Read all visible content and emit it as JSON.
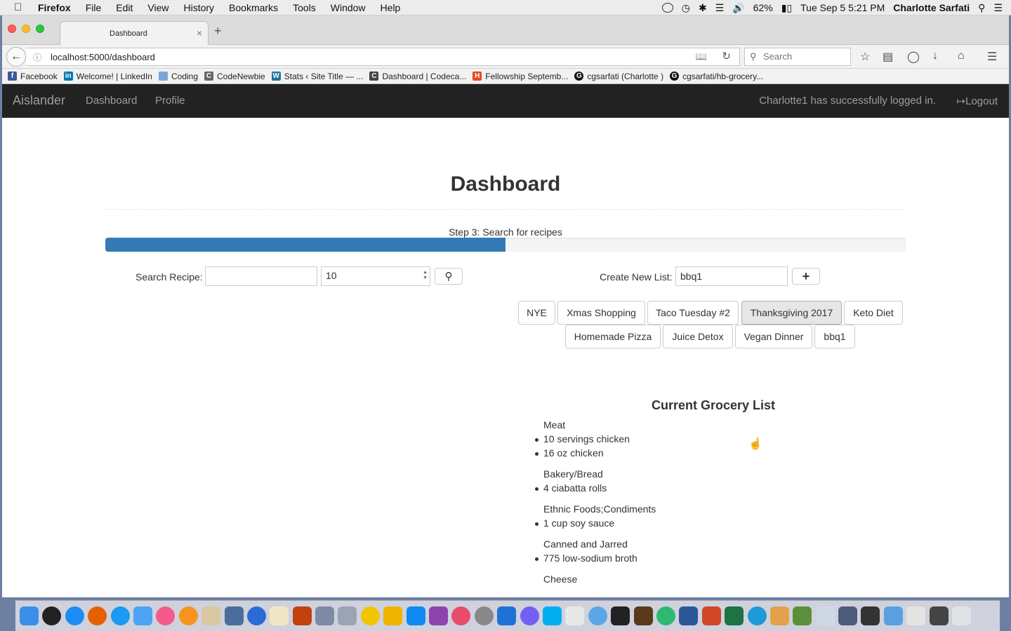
{
  "menubar": {
    "app": "Firefox",
    "menus": [
      "File",
      "Edit",
      "View",
      "History",
      "Bookmarks",
      "Tools",
      "Window",
      "Help"
    ],
    "battery": "62%",
    "clock": "Tue Sep 5  5:21 PM",
    "user": "Charlotte Sarfati"
  },
  "browser": {
    "tab_title": "Dashboard",
    "url": "localhost:5000/dashboard",
    "search_placeholder": "Search",
    "bookmarks": [
      {
        "label": "Facebook",
        "color": "#3b5998",
        "glyph": "f"
      },
      {
        "label": "Welcome! | LinkedIn",
        "color": "#0077b5",
        "glyph": "in"
      },
      {
        "label": "Coding",
        "color": "#7aa7d8",
        "glyph": ""
      },
      {
        "label": "CodeNewbie",
        "color": "#666666",
        "glyph": "C"
      },
      {
        "label": "Stats ‹ Site Title — ...",
        "color": "#21759b",
        "glyph": "W"
      },
      {
        "label": "Dashboard | Codeca...",
        "color": "#444444",
        "glyph": "C"
      },
      {
        "label": "Fellowship Septemb...",
        "color": "#e8491d",
        "glyph": "H"
      },
      {
        "label": "cgsarfati (Charlotte )",
        "color": "#111111",
        "glyph": "G"
      },
      {
        "label": "cgsarfati/hb-grocery...",
        "color": "#111111",
        "glyph": "G"
      }
    ]
  },
  "site": {
    "brand": "Aislander",
    "nav": [
      "Dashboard",
      "Profile"
    ],
    "login_message": "Charlotte1 has successfully logged in.",
    "logout": "Logout"
  },
  "page": {
    "title": "Dashboard",
    "step_label": "Step 3: Search for recipes",
    "progress_fraction": 0.5,
    "search_label": "Search Recipe:",
    "search_value": "",
    "count_value": "10",
    "create_label": "Create New List:",
    "create_value": "bbq1",
    "lists_row1": [
      "NYE",
      "Xmas Shopping",
      "Taco Tuesday #2",
      "Thanksgiving 2017",
      "Keto Diet"
    ],
    "lists_row2": [
      "Homemade Pizza",
      "Juice Detox",
      "Vegan Dinner",
      "bbq1"
    ]
  },
  "grocery": {
    "title": "Current Grocery List",
    "categories": [
      {
        "name": "Meat",
        "items": [
          "10 servings chicken",
          "16 oz chicken"
        ]
      },
      {
        "name": "Bakery/Bread",
        "items": [
          "4 ciabatta rolls"
        ]
      },
      {
        "name": "Ethnic Foods;Condiments",
        "items": [
          "1 cup soy sauce"
        ]
      },
      {
        "name": "Canned and Jarred",
        "items": [
          "775 low-sodium broth"
        ]
      },
      {
        "name": "Cheese",
        "items": []
      }
    ]
  }
}
